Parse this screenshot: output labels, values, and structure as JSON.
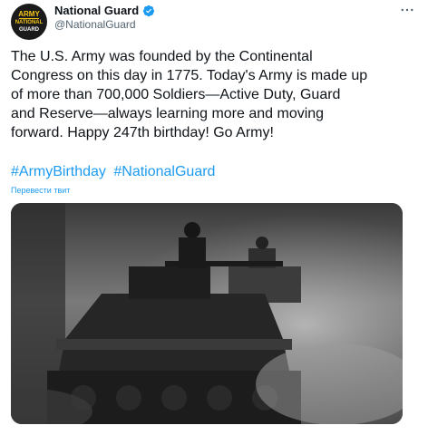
{
  "account": {
    "name": "National Guard",
    "handle": "@NationalGuard",
    "avatar_text": [
      "ARMY",
      "NATIONAL",
      "GUARD"
    ]
  },
  "tweet": {
    "text": "The U.S. Army was founded by the Continental\nCongress on this day in 1775. Today's Army is made up\nof more than 700,000 Soldiers—Active Duty, Guard\nand Reserve—always learning more and moving\nforward. Happy 247th birthday! Go Army!",
    "hashtags": [
      "#ArmyBirthday",
      "#NationalGuard"
    ],
    "translate_label": "Перевести твит"
  },
  "icons": {
    "verified": "verified-badge-icon",
    "more": "more-options-icon"
  },
  "colors": {
    "link": "#1d9bf0",
    "text": "#0f1419",
    "secondary": "#536471"
  }
}
